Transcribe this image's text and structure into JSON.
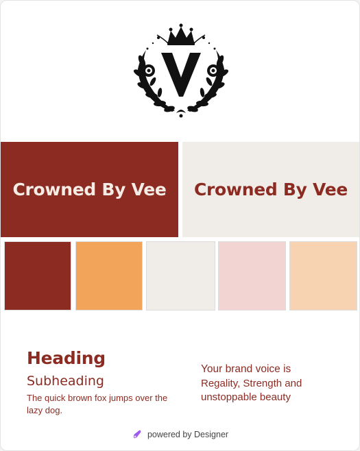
{
  "colors": {
    "primary": "#8b2b22",
    "light": "#f0ede9",
    "orange": "#f2a45a",
    "pink": "#f2d5d3",
    "peach": "#f7d3b1"
  },
  "brand": {
    "name_dark_banner": "Crowned By Vee",
    "name_light_banner": "Crowned By Vee"
  },
  "logo": {
    "icon": "crown-v-wreath-emblem",
    "monogram": "V"
  },
  "palette": [
    {
      "name": "red",
      "hex": "#8b2b22"
    },
    {
      "name": "orange",
      "hex": "#f2a45a"
    },
    {
      "name": "off-white",
      "hex": "#f0ede9"
    },
    {
      "name": "pink",
      "hex": "#f2d5d3"
    },
    {
      "name": "peach",
      "hex": "#f7d3b1"
    }
  ],
  "typography": {
    "heading": "Heading",
    "subheading": "Subheading",
    "body": "The quick brown fox jumps over the lazy dog."
  },
  "voice": {
    "title": "Your brand voice is",
    "description": "Regality, Strength and unstoppable beauty"
  },
  "footer": {
    "text": "powered by Designer",
    "icon": "designer-icon"
  }
}
